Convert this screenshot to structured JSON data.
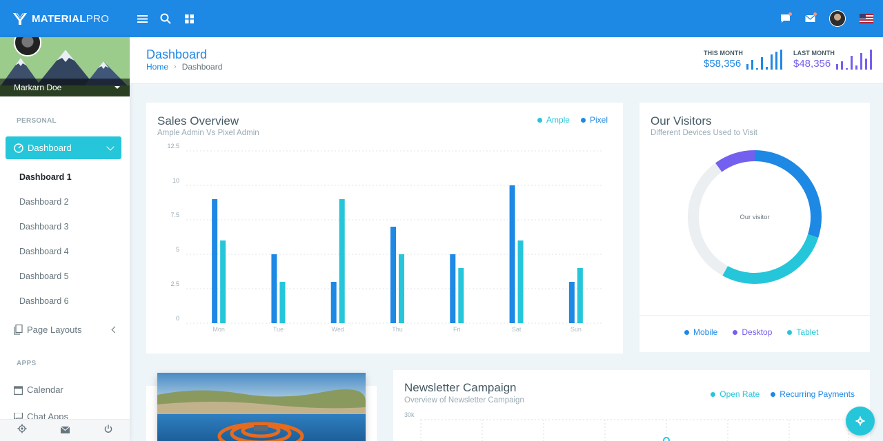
{
  "brand": {
    "name_bold": "MATERIAL",
    "name_light": "PRO"
  },
  "topbar": {
    "icons": [
      "menu-icon",
      "search-icon",
      "apps-grid-icon"
    ],
    "right_icons": [
      "message-icon",
      "mail-icon",
      "user-avatar",
      "us-flag-icon"
    ]
  },
  "sidebar": {
    "user_name": "Markarn Doe",
    "section_personal": "PERSONAL",
    "active_item": "Dashboard",
    "submenu": [
      "Dashboard 1",
      "Dashboard 2",
      "Dashboard 3",
      "Dashboard 4",
      "Dashboard 5",
      "Dashboard 6"
    ],
    "page_layouts": "Page Layouts",
    "section_apps": "APPS",
    "calendar": "Calendar",
    "chat_apps": "Chat Apps",
    "footer_icons": [
      "settings-icon",
      "mail-icon",
      "power-icon"
    ]
  },
  "page": {
    "title": "Dashboard",
    "breadcrumb": {
      "home": "Home",
      "current": "Dashboard"
    },
    "this_month": {
      "label": "THIS MONTH",
      "value": "$58,356",
      "color": "#1e88e5"
    },
    "last_month": {
      "label": "LAST MONTH",
      "value": "$48,356",
      "color": "#7460ee"
    }
  },
  "sales": {
    "title": "Sales Overview",
    "subtitle": "Ample Admin Vs Pixel Admin",
    "legend": [
      "Ample",
      "Pixel"
    ]
  },
  "visitors": {
    "title": "Our Visitors",
    "subtitle": "Different Devices Used to Visit",
    "center_label": "Our visitor",
    "legend": [
      "Mobile",
      "Desktop",
      "Tablet"
    ]
  },
  "newsletter": {
    "title": "Newsletter Campaign",
    "subtitle": "Overview of Newsletter Campaign",
    "legend": [
      "Open Rate",
      "Recurring Payments"
    ],
    "y_top_label": "30k"
  },
  "chart_data": [
    {
      "type": "bar",
      "categories": [
        "Mon",
        "Tue",
        "Wed",
        "Thu",
        "Fri",
        "Sat",
        "Sun"
      ],
      "series": [
        {
          "name": "Ample",
          "color": "#26c6da",
          "values": [
            6,
            3,
            9,
            5,
            4,
            6,
            4
          ]
        },
        {
          "name": "Pixel",
          "color": "#1e88e5",
          "values": [
            9,
            5,
            3,
            7,
            5,
            10,
            3
          ]
        }
      ],
      "ylim": [
        0,
        12.5
      ],
      "yticks": [
        "0",
        "2.5",
        "5",
        "7.5",
        "10",
        "12.5"
      ],
      "grid": true,
      "legend": "top-right"
    },
    {
      "type": "pie",
      "donut": true,
      "series": [
        {
          "name": "Mobile",
          "color": "#1e88e5",
          "value": 30
        },
        {
          "name": "Tablet",
          "color": "#26c6da",
          "value": 28
        },
        {
          "name": "(unlabeled)",
          "color": "#eceff1",
          "value": 32
        },
        {
          "name": "Desktop",
          "color": "#7460ee",
          "value": 10
        }
      ]
    }
  ]
}
